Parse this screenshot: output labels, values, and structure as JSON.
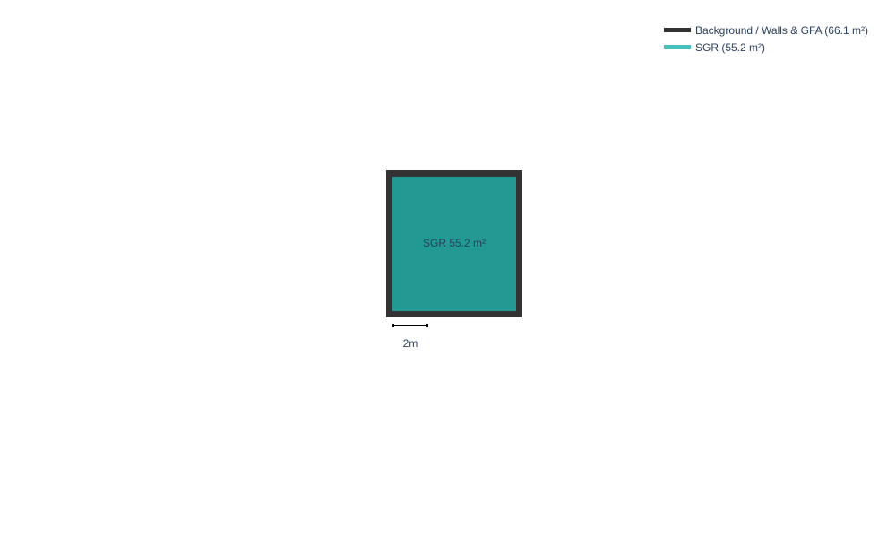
{
  "legend": {
    "items": [
      {
        "label": "Background / Walls & GFA (66.1 m²)",
        "color": "#333333"
      },
      {
        "label": "SGR (55.2 m²)",
        "color": "#4ac0bd"
      }
    ]
  },
  "plan": {
    "wall_color": "#333333",
    "room_color": "#229992",
    "room_label": "SGR 55.2 m²"
  },
  "scale": {
    "label": "2m"
  }
}
